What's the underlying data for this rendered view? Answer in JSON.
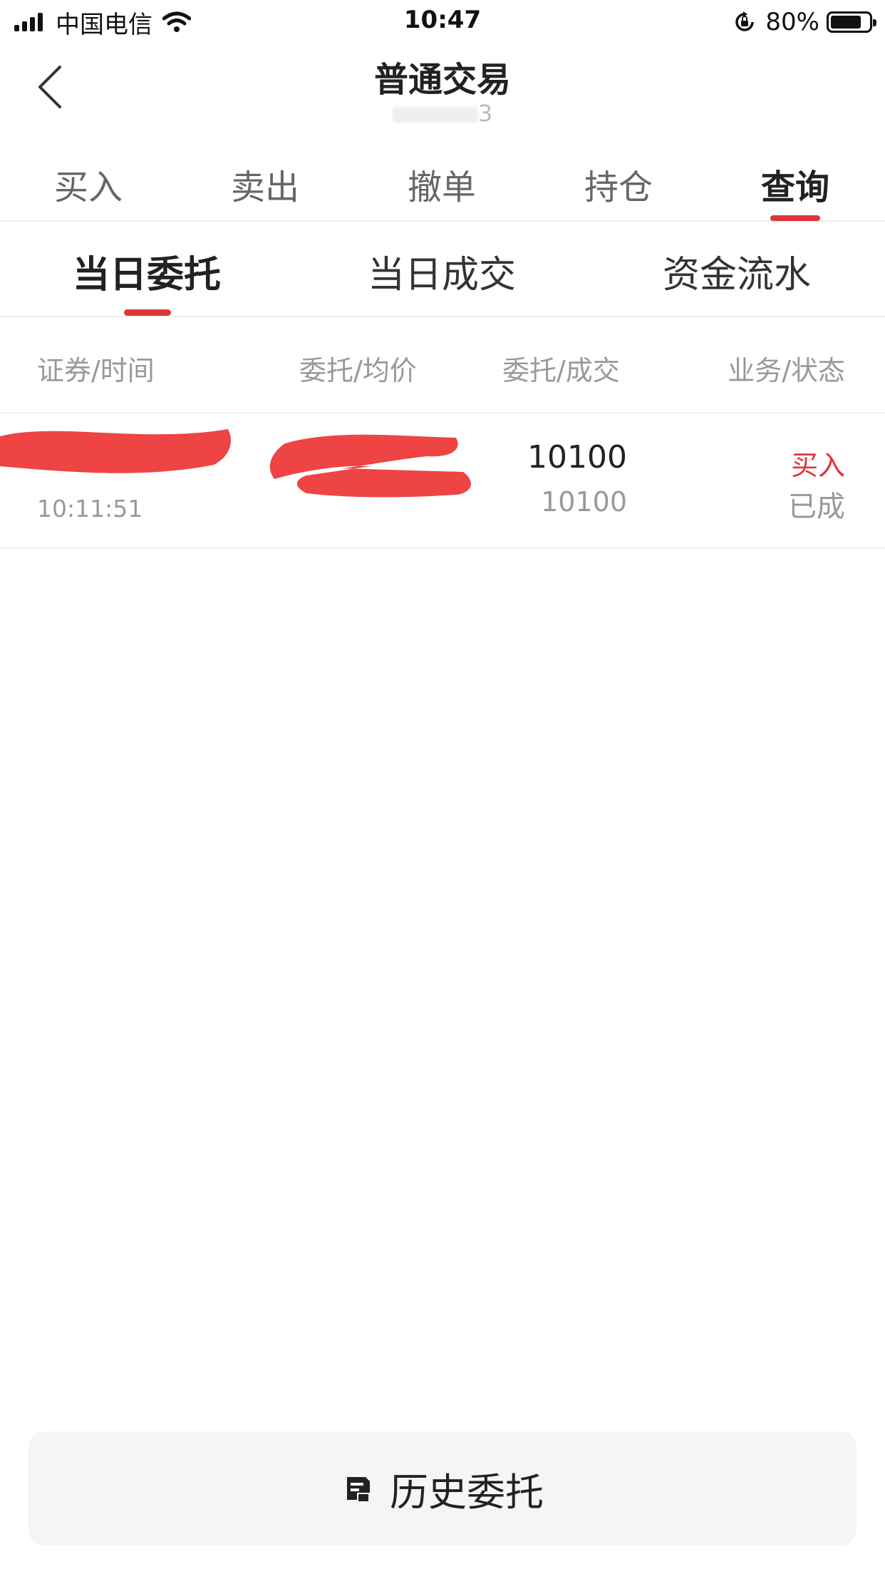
{
  "status_bar": {
    "carrier": "中国电信",
    "time": "10:47",
    "battery": "80%",
    "battery_level": 0.8
  },
  "header": {
    "title": "普通交易",
    "account": "3"
  },
  "main_tabs": [
    {
      "label": "买入",
      "active": false
    },
    {
      "label": "卖出",
      "active": false
    },
    {
      "label": "撤单",
      "active": false
    },
    {
      "label": "持仓",
      "active": false
    },
    {
      "label": "查询",
      "active": true
    }
  ],
  "sub_tabs": [
    {
      "label": "当日委托",
      "active": true
    },
    {
      "label": "当日成交",
      "active": false
    },
    {
      "label": "资金流水",
      "active": false
    }
  ],
  "columns": [
    "证券/时间",
    "委托/均价",
    "委托/成交",
    "业务/状态"
  ],
  "orders": [
    {
      "time": "10:11:51",
      "entrust_qty": "10100",
      "filled_qty": "10100",
      "business": "买入",
      "status": "已成"
    }
  ],
  "history_button": {
    "label": "历史委托",
    "icon": "history-icon"
  },
  "colors": {
    "accent": "#e0353b",
    "redaction": "#ee4444"
  }
}
